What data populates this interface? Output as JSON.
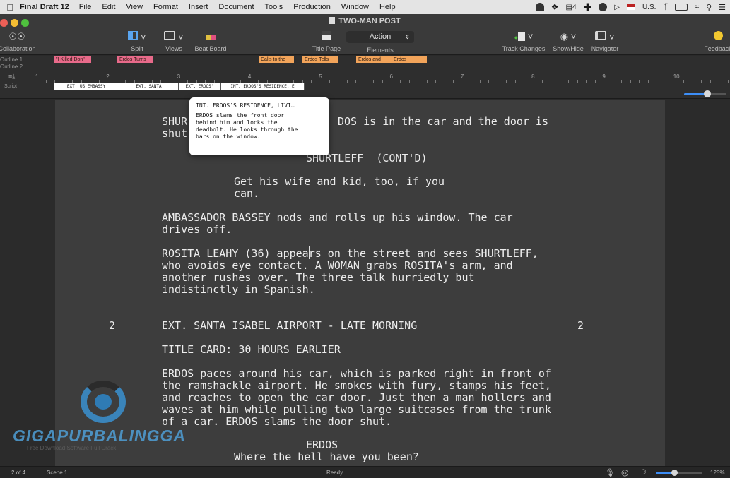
{
  "menubar": {
    "app_name": "Final Draft 12",
    "menus": [
      "File",
      "Edit",
      "View",
      "Format",
      "Insert",
      "Document",
      "Tools",
      "Production",
      "Window",
      "Help"
    ],
    "notification_count": "4",
    "input_source": "U.S."
  },
  "window": {
    "title": "TWO-MAN POST"
  },
  "toolbar": {
    "collaboration_label": "Collaboration",
    "split_label": "Split",
    "views_label": "Views",
    "beat_board_label": "Beat Board",
    "title_page_label": "Title Page",
    "elements_label": "Elements",
    "elements_value": "Action",
    "track_changes_label": "Track Changes",
    "show_hide_label": "Show/Hide",
    "navigator_label": "Navigator",
    "feedback_label": "Feedback"
  },
  "outline": {
    "outline1_label": "Outline 1",
    "outline2_label": "Outline 2",
    "script_label": "Script",
    "bars": [
      {
        "label": "\"I Killed Don\"",
        "color": "pink"
      },
      {
        "label": "Erdos Turns",
        "color": "pink"
      },
      {
        "label": "Calls to the",
        "color": "orange"
      },
      {
        "label": "Erdos Tells",
        "color": "orange"
      },
      {
        "label": "Erdos and",
        "color": "orange"
      },
      {
        "label": "Erdos",
        "color": "orange"
      }
    ],
    "ruler_ticks": [
      "1",
      "2",
      "3",
      "4",
      "5",
      "6",
      "7",
      "8",
      "9",
      "10"
    ],
    "scenes": [
      "EXT. US EMBASSY",
      "EXT. SANTA",
      "EXT. ERDOS'",
      "INT. ERDOS'S RESIDENCE, E"
    ]
  },
  "zoom_slider_fraction": 0.55,
  "tooltip": {
    "title": "INT. ERDOS'S RESIDENCE, LIVI…",
    "body": "ERDOS slams the front door\nbehind him and locks the\ndeadbolt. He looks through the\nbars on the window."
  },
  "script": {
    "line1_left": "SHUR",
    "line1_right": "DOS is in the car and the door is",
    "line2": "shut",
    "character1": "SHURTLEFF  (CONT'D)",
    "dialogue1_a": "Get his wife and kid, too, if you",
    "dialogue1_b": "can.",
    "action1_a": "AMBASSADOR BASSEY nods and rolls up his window. The car",
    "action1_b": "drives off.",
    "action2_a": "ROSITA LEAHY (36) appears on the street and sees SHURTLEFF,",
    "action2_b": "who avoids eye contact. A WOMAN grabs ROSITA's arm, and",
    "action2_c": "another rushes over. The three talk hurriedly but",
    "action2_d": "indistinctly in Spanish.",
    "scene_number": "2",
    "scene_heading": "EXT. SANTA ISABEL AIRPORT - LATE MORNING",
    "title_card": "TITLE CARD: 30 HOURS EARLIER",
    "action3_a": "ERDOS paces around his car, which is parked right in front of",
    "action3_b": "the ramshackle airport. He smokes with fury, stamps his feet,",
    "action3_c": "and reaches to open the car door. Just then a man hollers and",
    "action3_d": "waves at him while pulling two large suitcases from the trunk",
    "action3_e": "of a car. ERDOS slams the door shut.",
    "character2": "ERDOS",
    "dialogue2": "Where the hell have you been?"
  },
  "watermark": {
    "word": "GIGAPURBALINGGA",
    "sub": "Free Download Software Full Crack"
  },
  "statusbar": {
    "page": "2 of 4",
    "scene": "Scene 1",
    "state": "Ready",
    "zoom": "125%",
    "zoom_fraction": 0.4
  }
}
